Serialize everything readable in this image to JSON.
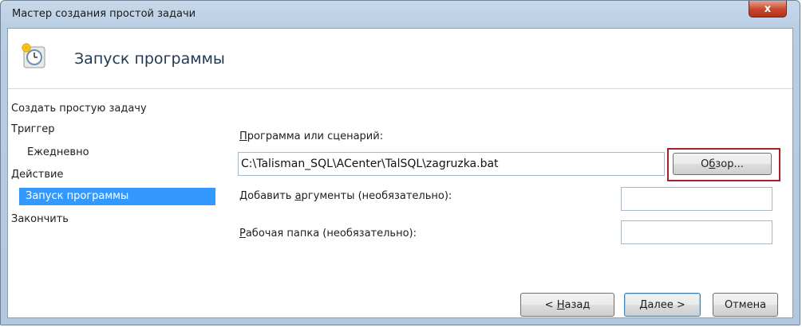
{
  "window": {
    "title": "Мастер создания простой задачи",
    "close_label": "x"
  },
  "header": {
    "title": "Запуск программы",
    "icon": "task-clock-icon"
  },
  "nav": {
    "items": [
      {
        "label": "Создать простую задачу"
      },
      {
        "label": "Триггер"
      },
      {
        "label": "Ежедневно"
      },
      {
        "label": "Действие"
      },
      {
        "label": "Запуск программы",
        "selected": true
      },
      {
        "label": "Закончить"
      }
    ]
  },
  "form": {
    "program_label_accel": "П",
    "program_label_rest": "рограмма или сценарий:",
    "program_value": "C:\\Talisman_SQL\\ACenter\\TalSQL\\zagruzka.bat",
    "browse_pre": "О",
    "browse_accel": "б",
    "browse_post": "зор...",
    "args_label_pre": "Добавить ",
    "args_label_accel": "а",
    "args_label_post": "ргументы (необязательно):",
    "args_value": "",
    "workdir_label_accel": "Р",
    "workdir_label_rest": "абочая папка (необязательно):",
    "workdir_value": ""
  },
  "buttons": {
    "back_prefix": "< ",
    "back_accel": "Н",
    "back_rest": "азад",
    "next_accel": "Д",
    "next_rest": "алее >",
    "cancel": "Отмена"
  },
  "colors": {
    "selection": "#3399ff",
    "highlight_border": "#a52226",
    "close_button": "#c8452c"
  }
}
